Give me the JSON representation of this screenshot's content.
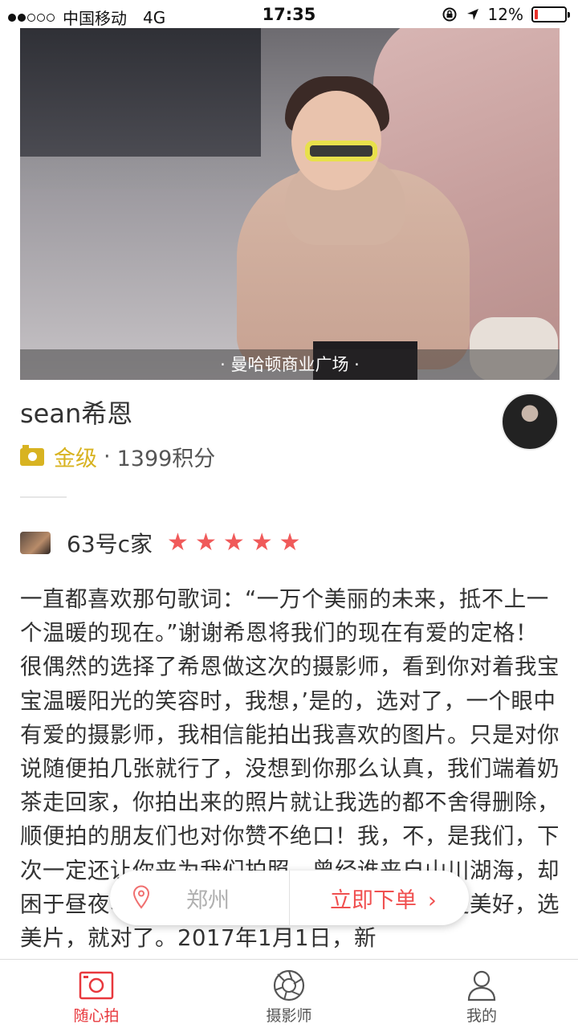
{
  "status_bar": {
    "carrier": "中国移动",
    "network": "4G",
    "time": "17:35",
    "battery": "12%",
    "battery_level": 0.12
  },
  "hero": {
    "location_caption": "· 曼哈顿商业广场 ·"
  },
  "photographer": {
    "name": "sean希恩",
    "level": "金级",
    "separator": "·",
    "points": "1399积分"
  },
  "review": {
    "author": "63号c家",
    "rating": 5,
    "text": "一直都喜欢那句歌词：“一万个美丽的未来，抵不上一个温暖的现在。”谢谢希恩将我们的现在有爱的定格！很偶然的选择了希恩做这次的摄影师，看到你对着我宝宝温暖阳光的笑容时，我想，’是的，选对了，一个眼中有爱的摄影师，我相信能拍出我喜欢的图片。只是对你说随便拍几张就行了，没想到你那么认真，我们端着奶茶走回家，你拍出来的照片就让我选的都不舍得删除，顺便拍的朋友们也对你赞不绝口！我，不，是我们，下次一定还让你来为我们拍照，曾经谁来自山川湖海，却困于昼夜、厨房与爱，你看，其实我们可以更美好，选美片，就对了。2017年1月1日，新"
  },
  "order_bar": {
    "city": "郑州",
    "order_label": "立即下单",
    "arrow": "›"
  },
  "tabs": [
    {
      "label": "随心拍",
      "icon": "camera-icon",
      "active": true
    },
    {
      "label": "摄影师",
      "icon": "aperture-icon",
      "active": false
    },
    {
      "label": "我的",
      "icon": "user-icon",
      "active": false
    }
  ],
  "colors": {
    "accent_red": "#e8383d",
    "gold": "#d8b321",
    "star": "#f05a5a"
  }
}
